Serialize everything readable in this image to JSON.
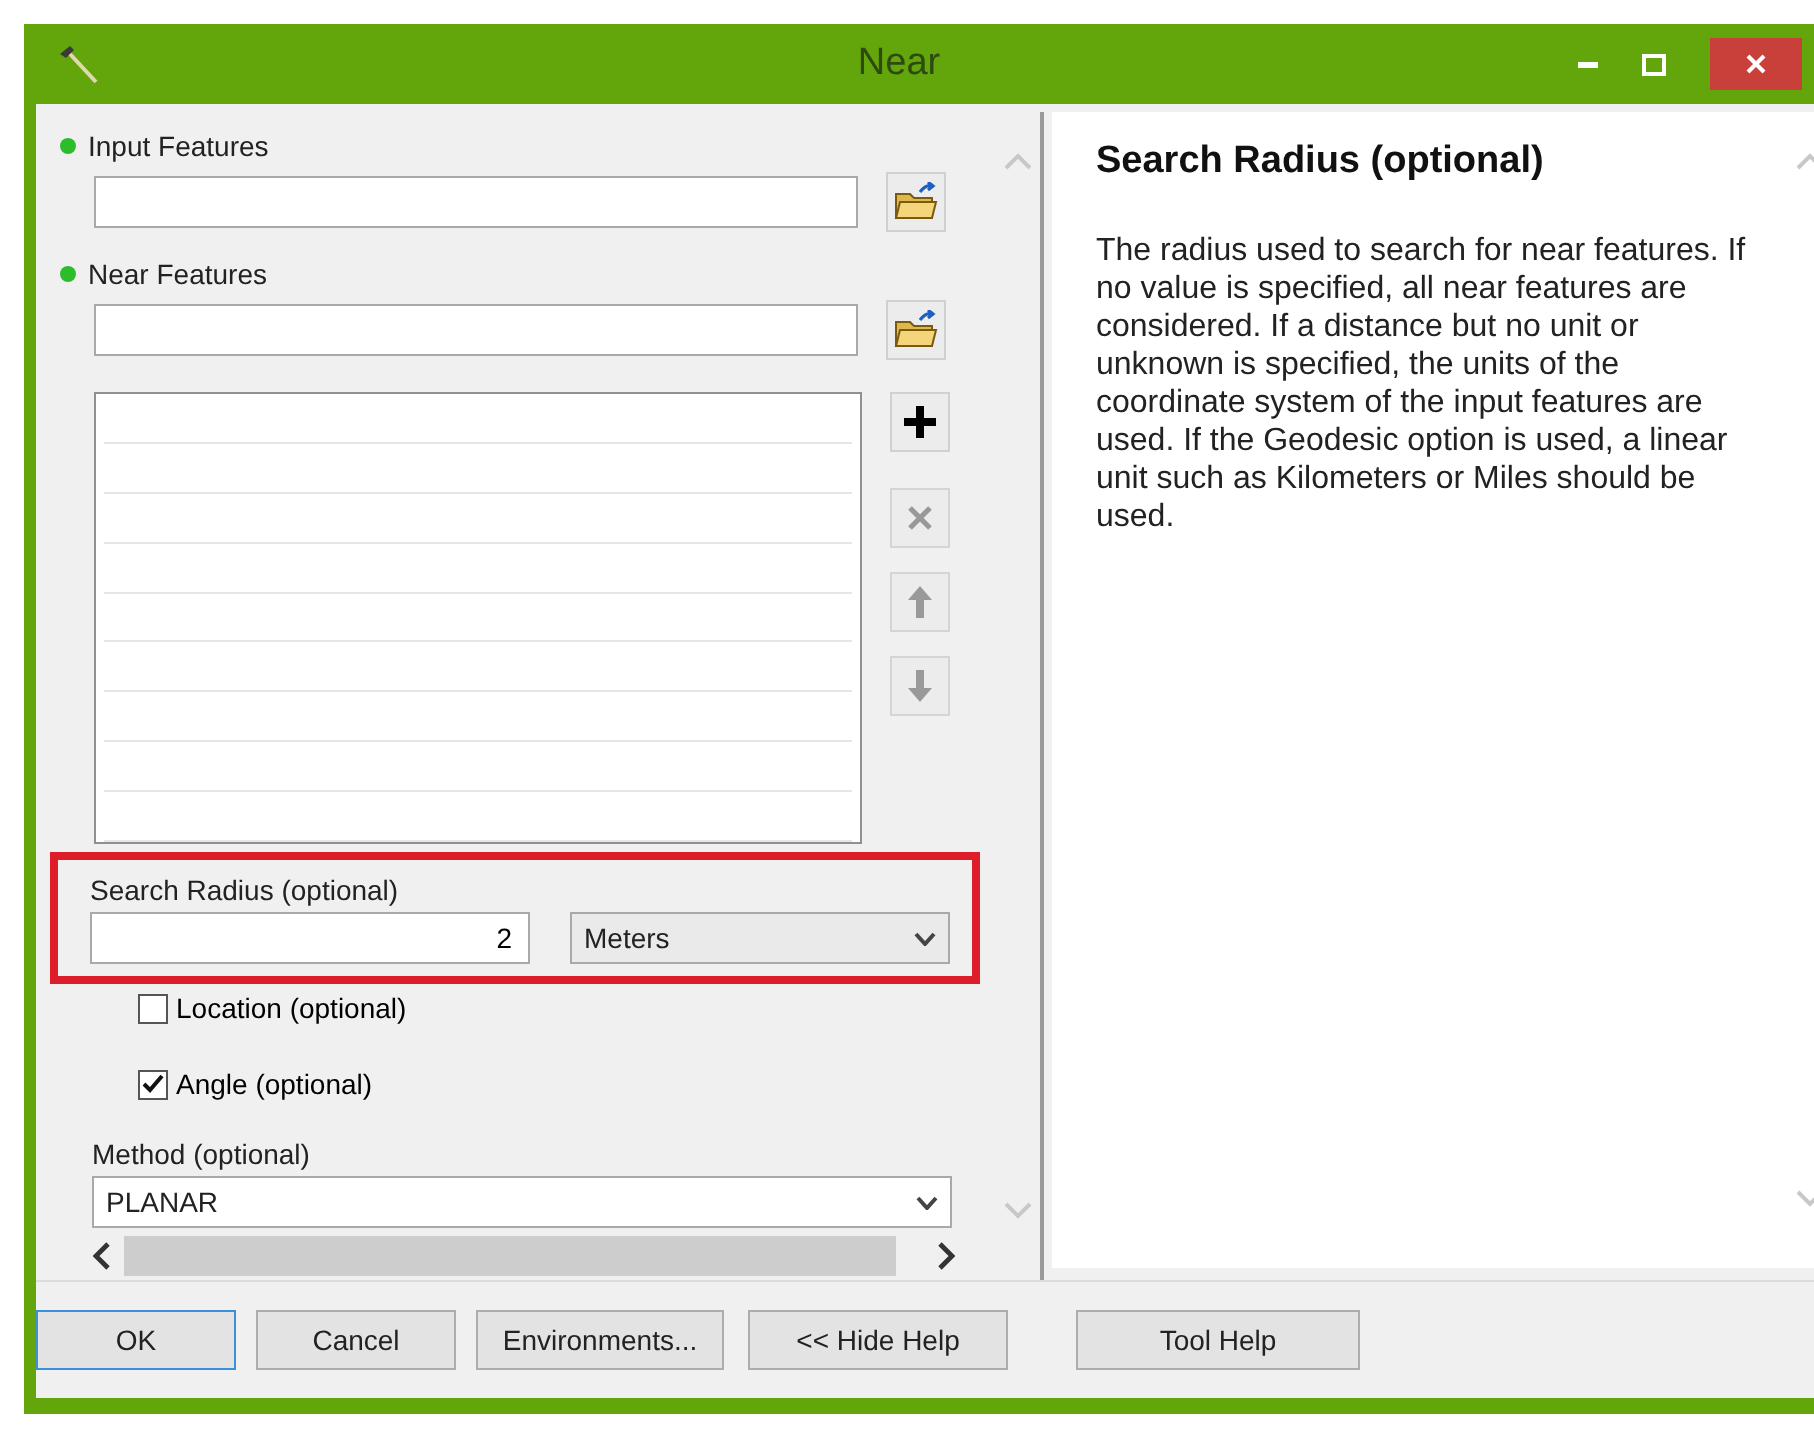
{
  "window": {
    "title": "Near"
  },
  "parameters": [
    {
      "kind": "feature",
      "label": "Input Features",
      "required": true
    },
    {
      "kind": "feature",
      "label": "Near Features",
      "required": true
    },
    {
      "kind": "list",
      "tools": [
        {
          "kind": "add",
          "disabled": false
        },
        {
          "kind": "remove",
          "disabled": true
        },
        {
          "kind": "up",
          "disabled": true
        },
        {
          "kind": "down",
          "disabled": true
        }
      ]
    },
    {
      "kind": "linear_unit",
      "label": "Search Radius (optional)",
      "value": "2",
      "unit": "Meters",
      "highlighted": true
    },
    {
      "kind": "checkbox",
      "label": "Location (optional)",
      "checked": false
    },
    {
      "kind": "checkbox",
      "label": "Angle (optional)",
      "checked": true
    },
    {
      "kind": "dropdown",
      "label": "Method (optional)",
      "value": "PLANAR"
    }
  ],
  "help": {
    "title": "Search Radius (optional)",
    "body": "The radius used to search for near features. If no value is specified, all near features are considered. If a distance but no unit or unknown is specified, the units of the coordinate system of the input features are used. If the Geodesic option is used, a linear unit such as Kilometers or Miles should be used."
  },
  "buttons": [
    {
      "label": "OK",
      "selected": true
    },
    {
      "label": "Cancel",
      "selected": false
    },
    {
      "label": "Environments...",
      "selected": false
    },
    {
      "label": "<< Hide Help",
      "selected": false
    },
    {
      "label": "Tool Help",
      "selected": false
    }
  ]
}
